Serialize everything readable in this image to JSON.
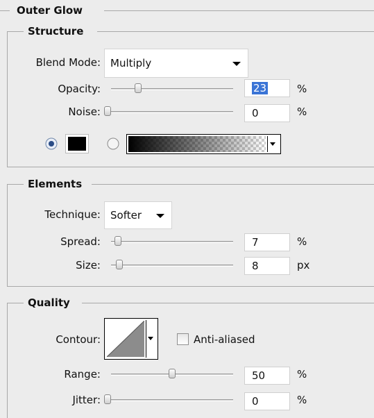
{
  "panel_title": "Outer Glow",
  "structure": {
    "title": "Structure",
    "blend_mode_label": "Blend Mode:",
    "blend_mode_value": "Multiply",
    "opacity_label": "Opacity:",
    "opacity_value": "23",
    "opacity_unit": "%",
    "noise_label": "Noise:",
    "noise_value": "0",
    "noise_unit": "%",
    "color_selected": "solid",
    "glow_color": "#000000"
  },
  "elements": {
    "title": "Elements",
    "technique_label": "Technique:",
    "technique_value": "Softer",
    "spread_label": "Spread:",
    "spread_value": "7",
    "spread_unit": "%",
    "size_label": "Size:",
    "size_value": "8",
    "size_unit": "px"
  },
  "quality": {
    "title": "Quality",
    "contour_label": "Contour:",
    "anti_aliased_label": "Anti-aliased",
    "anti_aliased_checked": false,
    "range_label": "Range:",
    "range_value": "50",
    "range_unit": "%",
    "jitter_label": "Jitter:",
    "jitter_value": "0",
    "jitter_unit": "%"
  },
  "colors": {
    "selection_highlight": "#3a74d6"
  }
}
